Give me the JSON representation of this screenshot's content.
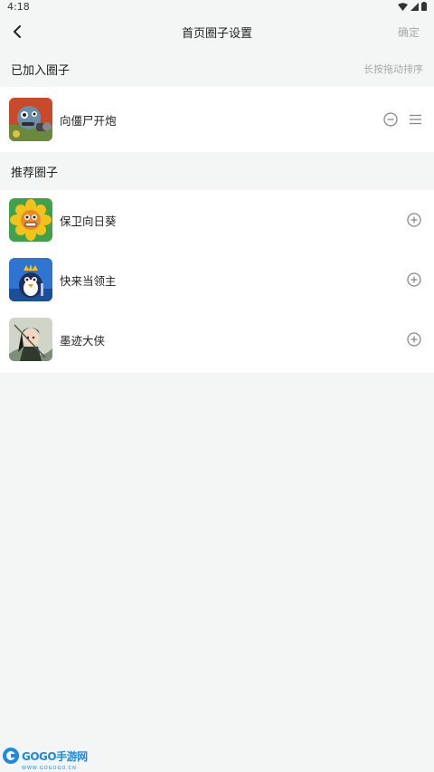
{
  "status": {
    "time": "4:18"
  },
  "header": {
    "title": "首页圈子设置",
    "confirm_label": "确定"
  },
  "joined": {
    "title": "已加入圈子",
    "hint": "长按拖动排序",
    "items": [
      {
        "name": "向僵尸开炮",
        "icon": "zombie-cannon-game-icon"
      }
    ]
  },
  "recommended": {
    "title": "推荐圈子",
    "items": [
      {
        "name": "保卫向日葵",
        "icon": "sunflower-game-icon"
      },
      {
        "name": "快来当领主",
        "icon": "penguin-king-game-icon"
      },
      {
        "name": "墨迹大侠",
        "icon": "ink-hero-game-icon"
      }
    ]
  },
  "watermark": {
    "text": "GOGO手游网",
    "sub": "WWW.GOGOGO.CN"
  }
}
